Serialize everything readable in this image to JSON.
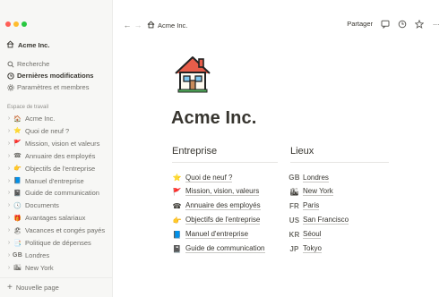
{
  "app": {
    "traffic_lights": [
      "#ff5f57",
      "#febc2e",
      "#28c840"
    ]
  },
  "sidebar": {
    "workspace_name": "Acme Inc.",
    "quick_links": [
      {
        "label": "Recherche",
        "icon": "search-icon"
      },
      {
        "label": "Dernières modifications",
        "icon": "clock-icon"
      },
      {
        "label": "Paramètres et membres",
        "icon": "gear-icon"
      }
    ],
    "section_label": "Espace de travail",
    "items": [
      {
        "label": "Acme Inc.",
        "icon": "house-icon",
        "glyph": "🏠"
      },
      {
        "label": "Quoi de neuf ?",
        "icon": "star-icon",
        "glyph": "⭐"
      },
      {
        "label": "Mission, vision et valeurs",
        "icon": "flag-icon",
        "glyph": "🚩"
      },
      {
        "label": "Annuaire des employés",
        "icon": "telephone-icon",
        "glyph": "☎"
      },
      {
        "label": "Objectifs de l'entreprise",
        "icon": "hand-icon",
        "glyph": "👉"
      },
      {
        "label": "Manuel d'entreprise",
        "icon": "blue-book-icon",
        "glyph": "📘"
      },
      {
        "label": "Guide de communication",
        "icon": "notebook-icon",
        "glyph": "📓"
      },
      {
        "label": "Documents",
        "icon": "clock-icon",
        "glyph": "🕓"
      },
      {
        "label": "Avantages salariaux",
        "icon": "gift-icon",
        "glyph": "🎁"
      },
      {
        "label": "Vacances et congés payés",
        "icon": "beach-icon",
        "glyph": "🏖"
      },
      {
        "label": "Politique de dépenses",
        "icon": "pages-icon",
        "glyph": "📑"
      },
      {
        "label": "Londres",
        "icon": "gb-flag-icon",
        "glyph": "GB"
      },
      {
        "label": "New York",
        "icon": "city-icon",
        "glyph": "🏙"
      }
    ],
    "new_page_label": "Nouvelle page"
  },
  "topbar": {
    "breadcrumb": "Acme Inc.",
    "share_label": "Partager"
  },
  "page": {
    "title": "Acme Inc.",
    "columns": [
      {
        "heading": "Entreprise",
        "links": [
          {
            "label": "Quoi de neuf ?",
            "icon": "star-icon",
            "glyph": "⭐"
          },
          {
            "label": "Mission, vision, valeurs",
            "icon": "flag-icon",
            "glyph": "🚩"
          },
          {
            "label": "Annuaire des employés",
            "icon": "telephone-icon",
            "glyph": "☎"
          },
          {
            "label": "Objectifs de l'entreprise",
            "icon": "hand-icon",
            "glyph": "👉"
          },
          {
            "label": "Manuel d'entreprise",
            "icon": "blue-book-icon",
            "glyph": "📘"
          },
          {
            "label": "Guide de communication",
            "icon": "notebook-icon",
            "glyph": "📓"
          }
        ]
      },
      {
        "heading": "Lieux",
        "links": [
          {
            "label": "Londres",
            "icon": "gb-flag-icon",
            "glyph": "GB"
          },
          {
            "label": "New York",
            "icon": "city-icon",
            "glyph": "🏙"
          },
          {
            "label": "Paris",
            "icon": "fr-flag-icon",
            "glyph": "FR"
          },
          {
            "label": "San Francisco",
            "icon": "us-flag-icon",
            "glyph": "US"
          },
          {
            "label": "Séoul",
            "icon": "kr-flag-icon",
            "glyph": "KR"
          },
          {
            "label": "Tokyo",
            "icon": "jp-flag-icon",
            "glyph": "JP"
          }
        ]
      }
    ]
  }
}
